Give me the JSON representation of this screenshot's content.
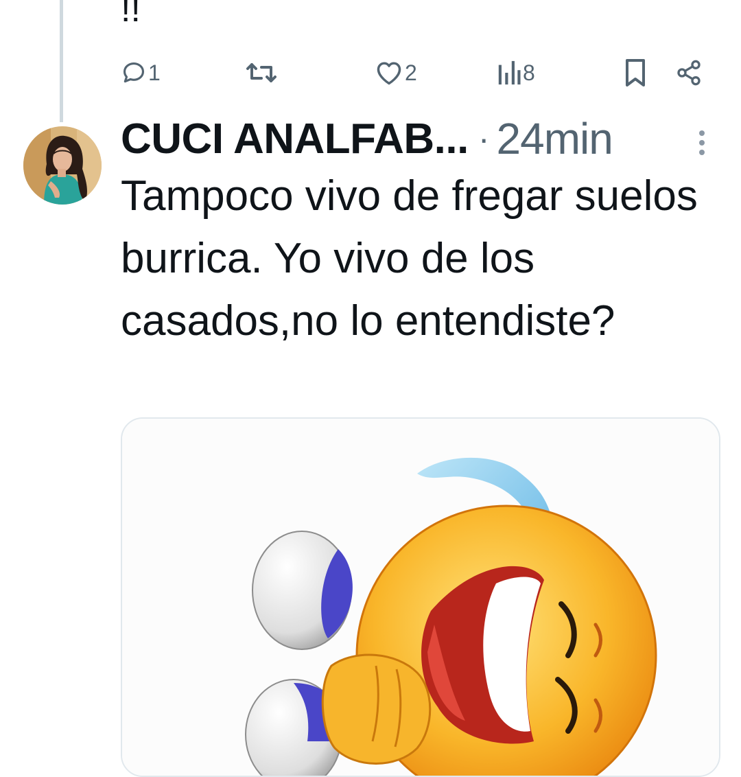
{
  "previous_tweet": {
    "text_tail": "!!",
    "actions": {
      "reply": {
        "icon": "reply-icon",
        "count": "1"
      },
      "retweet": {
        "icon": "retweet-icon",
        "count": ""
      },
      "like": {
        "icon": "heart-icon",
        "count": "2"
      },
      "views": {
        "icon": "views-icon",
        "count": "8"
      },
      "bookmark": {
        "icon": "bookmark-icon"
      },
      "share": {
        "icon": "share-icon"
      }
    }
  },
  "tweet": {
    "author_name": "CUCI ANALFAB...",
    "separator": "·",
    "timestamp": "24min",
    "text": "Tampoco vivo de fregar suelos burrica. Yo vivo de los casados,no lo entendiste?",
    "media": {
      "kind": "gif",
      "subject": "laughing-crying-emoji",
      "alt": ""
    },
    "more_icon": "more-vertical-icon"
  },
  "colors": {
    "text_primary": "#0f1419",
    "text_secondary": "#536471",
    "thread_line": "#cfd9de",
    "media_border": "#e1e8ed"
  }
}
